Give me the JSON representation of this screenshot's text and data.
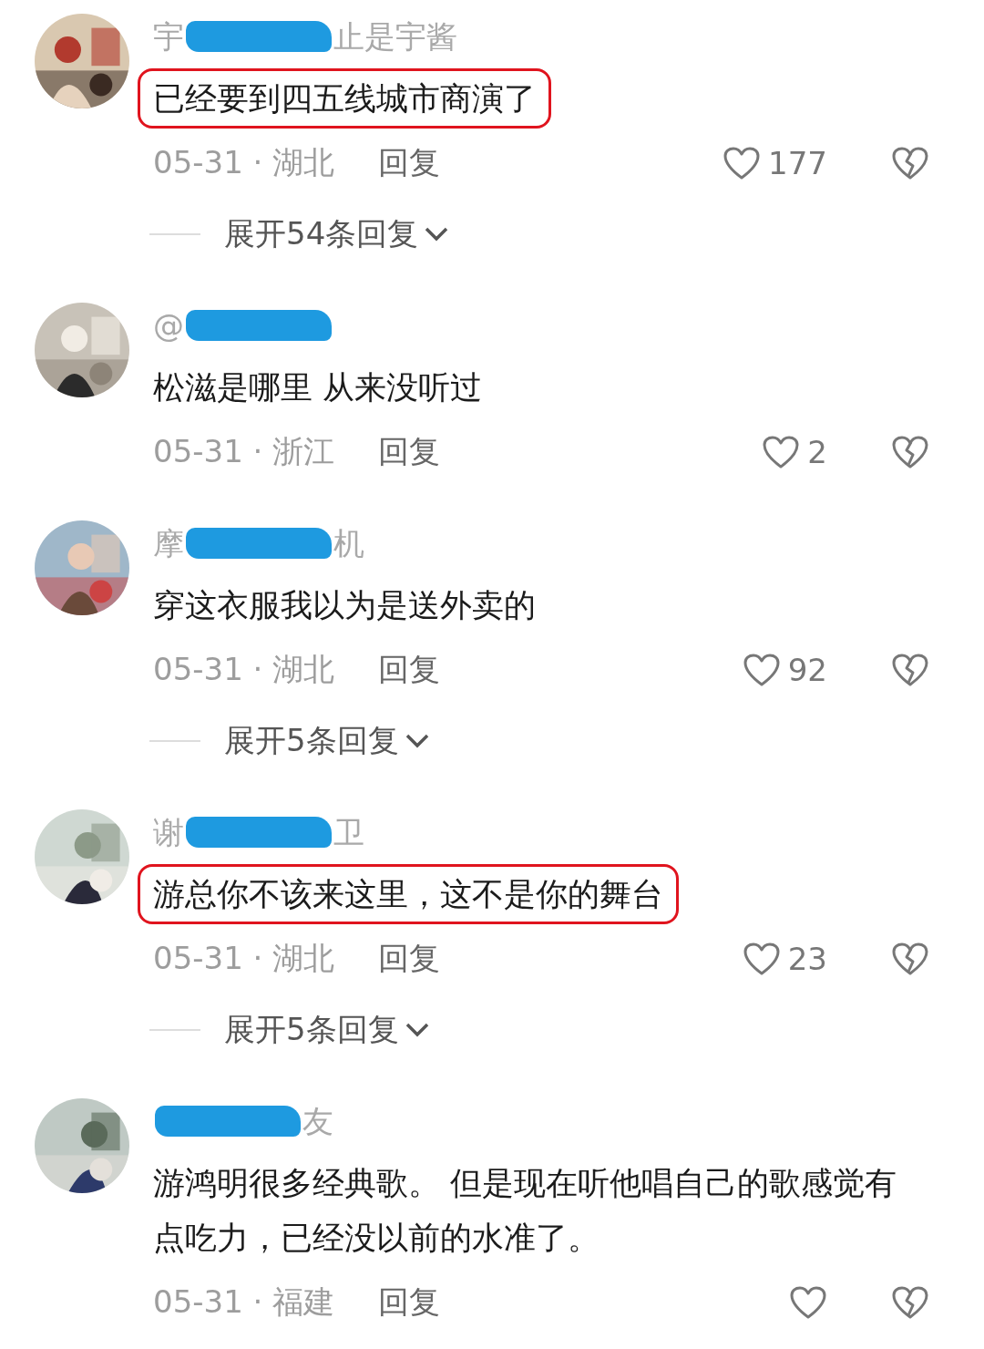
{
  "comments": [
    {
      "name": {
        "before": "宇",
        "after": "止是宇酱"
      },
      "text": "已经要到四五线城市商演了",
      "highlighted": true,
      "date": "05-31 · 湖北",
      "reply": "回复",
      "likes": "177",
      "expand": "展开54条回复"
    },
    {
      "name": {
        "before": "@"
      },
      "text": "松滋是哪里 从来没听过",
      "highlighted": false,
      "date": "05-31 · 浙江",
      "reply": "回复",
      "likes": "2"
    },
    {
      "name": {
        "before": "摩",
        "after": "机"
      },
      "text": "穿这衣服我以为是送外卖的",
      "highlighted": false,
      "date": "05-31 · 湖北",
      "reply": "回复",
      "likes": "92",
      "expand": "展开5条回复"
    },
    {
      "name": {
        "before": "谢",
        "after": "卫"
      },
      "text": "游总你不该来这里，这不是你的舞台",
      "highlighted": true,
      "date": "05-31 · 湖北",
      "reply": "回复",
      "likes": "23",
      "expand": "展开5条回复"
    },
    {
      "name": {
        "after": "友"
      },
      "text": "游鸿明很多经典歌。 但是现在听他唱自己的歌感觉有点吃力，已经没以前的水准了。",
      "highlighted": false,
      "date": "05-31 · 福建",
      "reply": "回复"
    }
  ]
}
